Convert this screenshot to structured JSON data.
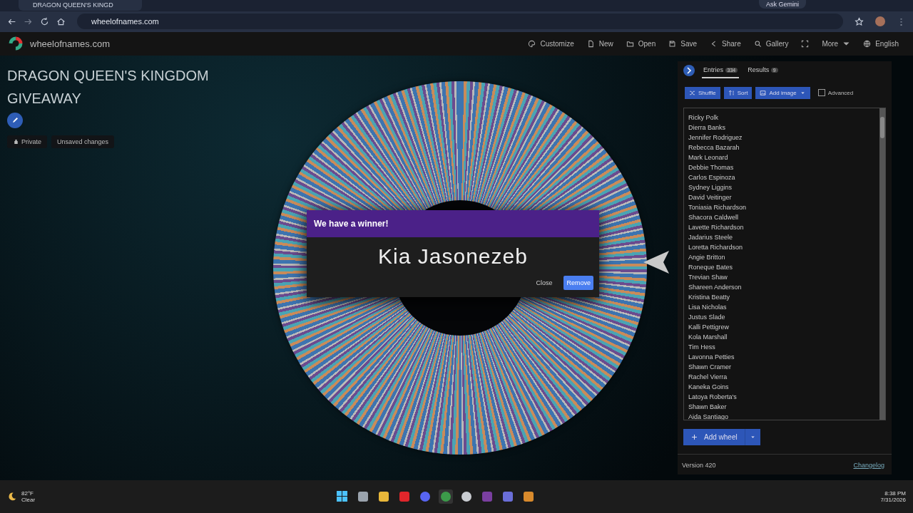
{
  "browser": {
    "tabs": [
      {
        "title": "DRAGON QUEEN'S KINGD",
        "selected": true
      }
    ],
    "address": "wheelofnames.com",
    "ask_button": "Ask Gemini"
  },
  "site": {
    "logo_text": "wheelofnames.com",
    "menu": [
      {
        "kind": "palette",
        "label": "Customize"
      },
      {
        "kind": "file",
        "label": "New"
      },
      {
        "kind": "folder",
        "label": "Open"
      },
      {
        "kind": "save",
        "label": "Save"
      },
      {
        "kind": "share",
        "label": "Share"
      },
      {
        "kind": "search",
        "label": "Gallery"
      },
      {
        "kind": "fullscreen"
      },
      {
        "kind": "more",
        "label": "More"
      },
      {
        "kind": "globe",
        "label": "English"
      }
    ]
  },
  "wheel_title": "DRAGON QUEEN'S KINGDOM GIVEAWAY",
  "chips": [
    {
      "kind": "lock",
      "label": "Private"
    },
    {
      "kind": "plain",
      "label": "Unsaved changes"
    }
  ],
  "dialog": {
    "title": "We have a winner!",
    "winner": "Kia Jasonezeb",
    "buttons": [
      {
        "label": "Close",
        "kind": "text"
      },
      {
        "label": "Remove",
        "kind": "primary"
      }
    ]
  },
  "panel": {
    "tabs": [
      {
        "label": "Entries",
        "count": "334",
        "selected": true
      },
      {
        "label": "Results",
        "count": "9",
        "selected": false
      }
    ],
    "actions": [
      {
        "kind": "shuffle",
        "label": "Shuffle"
      },
      {
        "kind": "sort",
        "label": "Sort"
      },
      {
        "kind": "image",
        "label": "Add image"
      }
    ],
    "advanced": {
      "label": "Advanced",
      "checked": false
    },
    "entries": [
      "Ricky Polk",
      "Dierra Banks",
      "Jennifer Rodriguez",
      "Rebecca Bazarah",
      "Mark Leonard",
      "Debbie Thomas",
      "Carlos Espinoza",
      "Sydney Liggins",
      "David Veitinger",
      "Toniasia Richardson",
      "Shacora Caldwell",
      "Lavette Richardson",
      "Jadarius Steele",
      "Loretta Richardson",
      "Angie Britton",
      "Roneque Bates",
      "Trevian Shaw",
      "Shareen Anderson",
      "Kristina Beatty",
      "Lisa Nicholas",
      "Justus Slade",
      "Kalli Pettigrew",
      "Kola Marshall",
      "Tim Hess",
      "Lavonna Petties",
      "Shawn Cramer",
      "Rachel Vierra",
      "Kaneka Goins",
      "Latoya Roberta's",
      "Shawn Baker",
      "Aida Santiago"
    ],
    "add_wheel": "Add wheel",
    "version": "Version 420",
    "changelog": "Changelog"
  },
  "taskbar": {
    "weather_temp": "82°F",
    "weather_text": "Clear",
    "apps": [
      {
        "kind": "windows",
        "selected": false
      },
      {
        "kind": "window",
        "selected": false
      },
      {
        "kind": "folder",
        "selected": false
      },
      {
        "kind": "video",
        "selected": false
      },
      {
        "kind": "chat",
        "selected": false
      },
      {
        "kind": "browser",
        "selected": true
      },
      {
        "kind": "clock",
        "selected": false
      },
      {
        "kind": "game",
        "selected": false
      },
      {
        "kind": "puzzle",
        "selected": false
      },
      {
        "kind": "dragon",
        "selected": false
      }
    ],
    "time": "8:38 PM",
    "date": "7/31/2026"
  }
}
